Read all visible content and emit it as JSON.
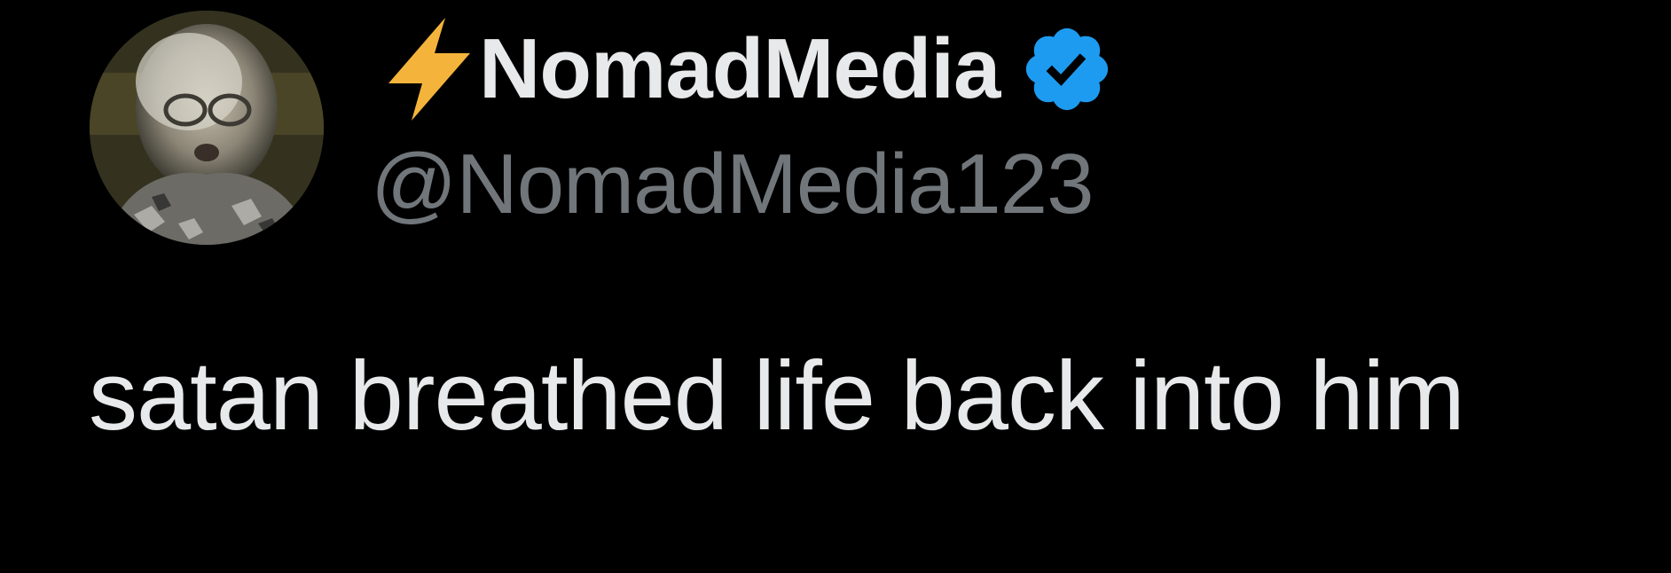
{
  "author": {
    "display_name": "NomadMedia",
    "handle": "@NomadMedia123",
    "name_prefix_icon": "lightning-bolt-icon",
    "badge_icon": "verified-badge-icon",
    "avatar": "profile-photo"
  },
  "tweet": {
    "text": "satan breathed life back into him"
  },
  "colors": {
    "background": "#000000",
    "primary_text": "#e7e9ea",
    "secondary_text": "#71767b",
    "verified_blue": "#1d9bf0",
    "bolt_yellow": "#f4b43c"
  }
}
